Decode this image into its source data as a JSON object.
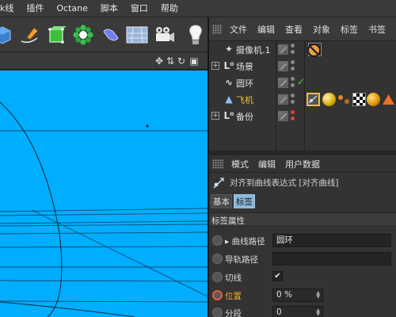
{
  "menubar": {
    "items": [
      "样条线",
      "插件",
      "Octane",
      "脚本",
      "窗口",
      "帮助"
    ],
    "first_visible": "k线"
  },
  "toolbar": {
    "tools": [
      "cube-tool-icon",
      "pen-tool-icon",
      "cube-generator-icon",
      "mograph-cloner-icon",
      "deformer-icon",
      "floor-icon",
      "camera-icon",
      "light-icon"
    ]
  },
  "object_manager": {
    "menu": [
      "文件",
      "编辑",
      "查看",
      "对象",
      "标签",
      "书签"
    ],
    "objects": [
      {
        "name": "摄像机.1",
        "icon": "camera-icon",
        "expand": "",
        "tags": [
          "target-tag-icon",
          "no-render-tag-icon"
        ]
      },
      {
        "name": "场景",
        "icon": "null-icon",
        "expand": "+",
        "tags": []
      },
      {
        "name": "圆环",
        "icon": "spline-icon",
        "expand": "",
        "tags": [
          "check-icon"
        ]
      },
      {
        "name": "飞机",
        "icon": "plane-null-icon",
        "expand": "",
        "tags": [
          "align-to-spline-tag-icon",
          "material-tag-icon",
          "vibrate-tag-icon",
          "checker-tag-icon",
          "material-tag-icon",
          "warning-tag-icon"
        ]
      },
      {
        "name": "备份",
        "icon": "null-icon",
        "expand": "+",
        "tags": []
      }
    ],
    "colors": {
      "selected_name": "#f2c230",
      "accent": "#f5a623"
    }
  },
  "attribute_manager": {
    "menu": [
      "模式",
      "编辑",
      "用户数据"
    ],
    "title": "对齐到曲线表达式 [对齐曲线]",
    "tabs": [
      {
        "label": "基本",
        "active": false
      },
      {
        "label": "标签",
        "active": true
      }
    ],
    "group_title": "标签属性",
    "properties": [
      {
        "label": "▸ 曲线路径",
        "value": "圆环",
        "highlight": false,
        "animated": false
      },
      {
        "label": "导轨路径",
        "value": "",
        "highlight": false,
        "animated": false
      },
      {
        "label": "切线",
        "value": "✔",
        "highlight": false,
        "animated": false
      },
      {
        "label": "位置",
        "value": "0 %",
        "highlight": true,
        "animated": true
      },
      {
        "label": "分段",
        "value": "0",
        "highlight": false,
        "animated": false
      }
    ]
  },
  "viewport": {
    "nav_icons": [
      "move-view-icon",
      "pan-view-icon",
      "rotate-view-icon",
      "maximize-view-icon"
    ],
    "background": "#00aeff"
  }
}
